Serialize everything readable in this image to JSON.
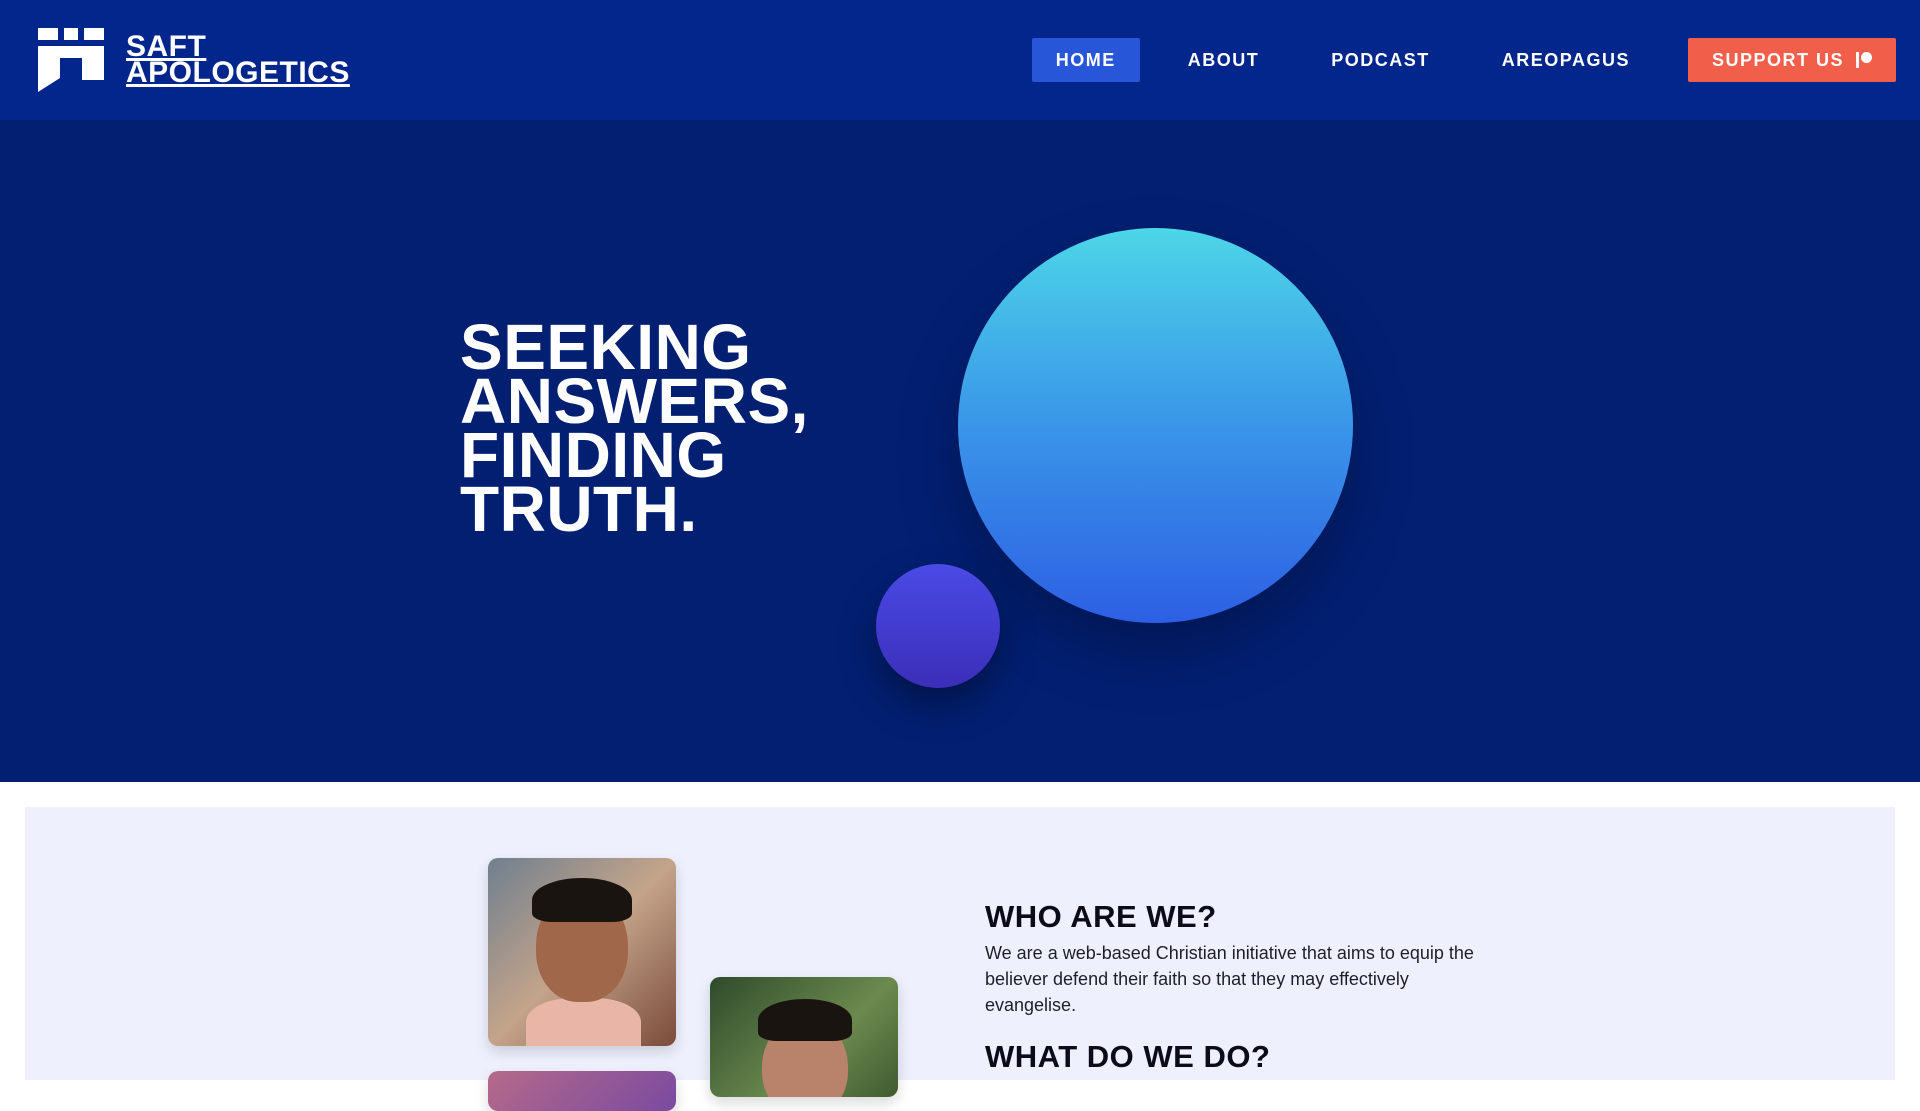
{
  "header": {
    "brand_line1": "SAFT",
    "brand_line2": "APOLOGETICS",
    "logo_icon": "cross-flag-logo",
    "nav": [
      {
        "label": "HOME",
        "active": true
      },
      {
        "label": "ABOUT",
        "active": false
      },
      {
        "label": "PODCAST",
        "active": false
      },
      {
        "label": "AREOPAGUS",
        "active": false
      }
    ],
    "support_label": "SUPPORT US",
    "support_icon": "patreon-icon"
  },
  "hero": {
    "title_lines": [
      "SEEKING",
      "ANSWERS,",
      "FINDING",
      "TRUTH."
    ]
  },
  "about": {
    "who_title": "WHO ARE WE?",
    "who_body": "We are a web-based Christian initiative that aims to equip the believer defend their faith so that they may effectively evangelise.",
    "what_title": "WHAT DO WE DO?"
  },
  "colors": {
    "header_bg": "#03268c",
    "hero_bg": "#021f72",
    "nav_active_bg": "#2756d8",
    "support_bg": "#f15f4b",
    "about_bg": "#eef0fd"
  }
}
